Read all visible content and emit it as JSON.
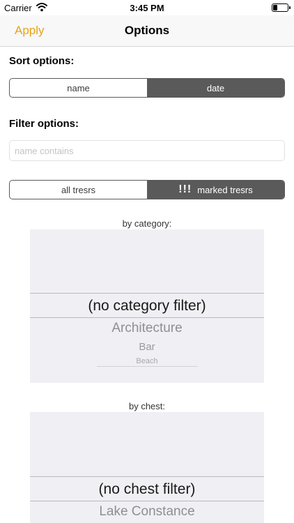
{
  "status_bar": {
    "carrier": "Carrier",
    "time": "3:45 PM",
    "wifi_icon": "wifi-icon",
    "battery_icon": "battery-icon"
  },
  "nav": {
    "apply_label": "Apply",
    "title": "Options",
    "accent_color": "#e8a317"
  },
  "sort": {
    "label": "Sort options:",
    "segments": [
      "name",
      "date"
    ],
    "selected": "date"
  },
  "filter": {
    "label": "Filter options:",
    "name_placeholder": "name contains",
    "name_value": "",
    "marked_segments": {
      "all": "all tresrs",
      "marked_bang": "!!!",
      "marked": "marked tresrs"
    },
    "marked_selected": "marked tresrs"
  },
  "category_picker": {
    "label": "by category:",
    "selected": "(no category filter)",
    "items": [
      "Architecture",
      "Bar",
      "Beach"
    ]
  },
  "chest_picker": {
    "label": "by chest:",
    "selected": "(no chest filter)",
    "items": [
      "Lake Constance"
    ]
  }
}
